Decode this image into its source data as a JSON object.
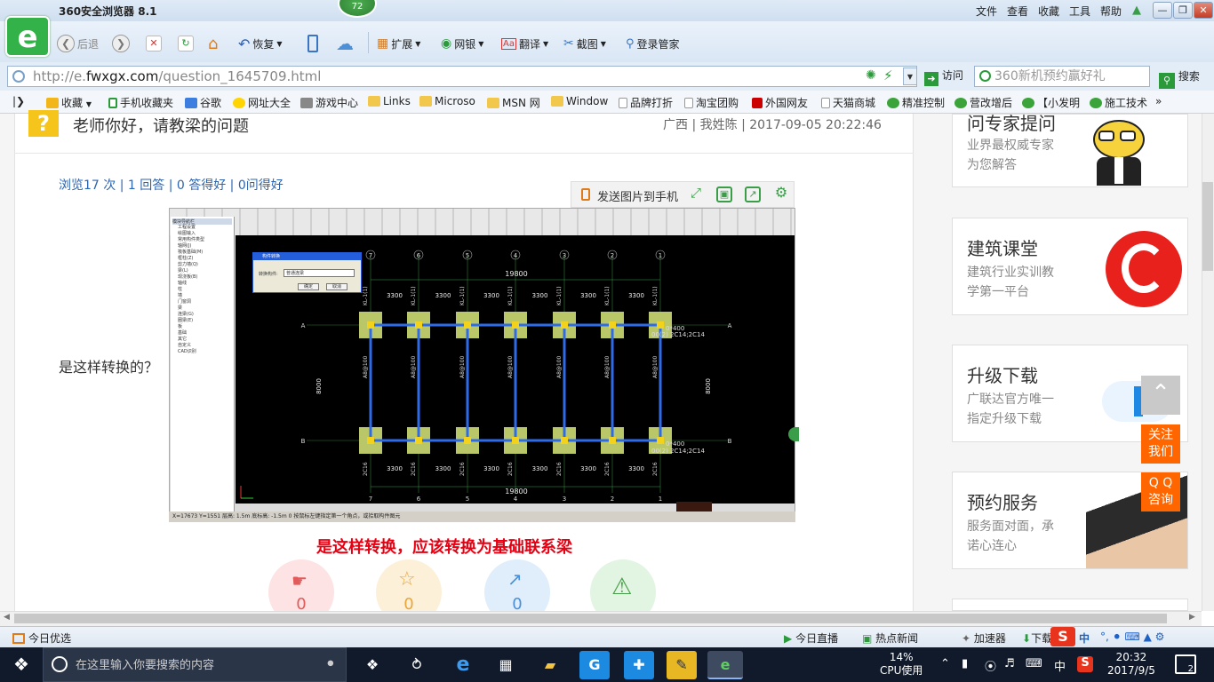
{
  "window": {
    "title": "360安全浏览器 8.1",
    "badge": "72",
    "menu": [
      "文件",
      "查看",
      "收藏",
      "工具",
      "帮助"
    ]
  },
  "toolbar": {
    "back": "后退",
    "restore": "恢复",
    "extend": "扩展",
    "bank": "网银",
    "translate": "翻译",
    "screenshot": "截图",
    "login_manager": "登录管家"
  },
  "address": {
    "url_prefix": "http://e.",
    "url_domain": "fwxgx.com",
    "url_path": "/question_1645709.html",
    "visit": "访问",
    "search_placeholder": "360新机预约赢好礼",
    "search_btn": "搜索"
  },
  "favorites": [
    "收藏",
    "手机收藏夹",
    "谷歌",
    "网址大全",
    "游戏中心",
    "Links",
    "Microso",
    "MSN 网",
    "Window",
    "品牌打折",
    "淘宝团购",
    "外国网友",
    "天猫商城",
    "精准控制",
    "营改增后",
    "【小发明",
    "施工技术"
  ],
  "question": {
    "title": "老师你好，请教梁的问题",
    "meta": "广西 | 我姓陈 | 2017-09-05 20:22:46",
    "stats": "浏览17 次 | 1 回答 | 0 答得好 | 0问得好",
    "body": "是这样转换的？",
    "send_to_phone": "发送图片到手机",
    "caption": "是这样转换，应该转换为基础联系梁",
    "reactions": [
      "0",
      "0",
      "0"
    ]
  },
  "cad": {
    "tree_title": "模块导航栏",
    "tree_items": [
      "工程设置",
      "绘图输入",
      "常用构件类型",
      "轴网(J)",
      "筏板基础(M)",
      "框柱(Z)",
      "剪力墙(Q)",
      "梁(L)",
      "现浇板(B)",
      "轴线",
      "柱",
      "墙",
      "门窗洞",
      "梁",
      "连梁(G)",
      "圈梁(E)",
      "板",
      "基础",
      "其它",
      "自定义",
      "CAD识别"
    ],
    "dialog_title": "构件转换",
    "dialog_label": "转换构件:",
    "dialog_select": "普通连梁",
    "dialog_ok": "确定",
    "dialog_cancel": "取消",
    "top_dim": "19800",
    "bottom_dim": "19800",
    "spans": [
      "3300",
      "3300",
      "3300",
      "3300",
      "3300",
      "3300"
    ],
    "side_dim": "8000",
    "axes_top": [
      "7",
      "6",
      "5",
      "4",
      "3",
      "2",
      "1"
    ],
    "axes_side": [
      "A",
      "B"
    ],
    "beam_label_a": "0*400",
    "beam_label_b": "00(2) 2C14;2C14",
    "status": "X=17673 Y=1551  层高: 1.5m  底标高: -1.5m  0   按鼠标左键指定第一个角点，或拾取构件图元"
  },
  "sidebar": [
    {
      "title": "问专家提问",
      "lines": [
        "业界最权威专家",
        "为您解答"
      ]
    },
    {
      "title": "建筑课堂",
      "lines": [
        "建筑行业实训教",
        "学第一平台"
      ]
    },
    {
      "title": "升级下载",
      "lines": [
        "广联达官方唯一",
        "指定升级下载"
      ]
    },
    {
      "title": "预约服务",
      "lines": [
        "服务面对面，承",
        "诺心连心"
      ]
    }
  ],
  "float": {
    "contact": [
      "关注",
      "我们"
    ],
    "qq": [
      "Q Q",
      "咨询"
    ]
  },
  "statusbar": {
    "left": "今日优选",
    "live": "今日直播",
    "hot": "热点新闻",
    "accel": "加速器",
    "download": "下载",
    "ime": "中"
  },
  "taskbar": {
    "search_placeholder": "在这里输入你要搜索的内容",
    "cpu_pct": "14%",
    "cpu_label": "CPU使用",
    "ime": "中",
    "time": "20:32",
    "date": "2017/9/5",
    "notif": "2"
  }
}
